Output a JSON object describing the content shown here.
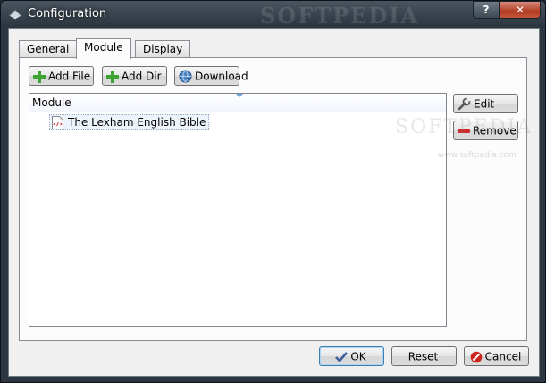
{
  "window": {
    "title": "Configuration",
    "watermark": "SOFTPEDIA",
    "help_label": "?",
    "close_label": "✕"
  },
  "tabs": [
    {
      "label": "General"
    },
    {
      "label": "Module",
      "active": true
    },
    {
      "label": "Display"
    }
  ],
  "toolbar": {
    "add_file": "Add File",
    "add_dir": "Add Dir",
    "download": "Download"
  },
  "modules": {
    "column_header": "Module",
    "items": [
      {
        "label": "The Lexham English Bible"
      }
    ]
  },
  "side_buttons": {
    "edit": "Edit",
    "remove": "Remove"
  },
  "dialog": {
    "ok": "OK",
    "reset": "Reset",
    "cancel": "Cancel"
  },
  "page_watermark": {
    "text": "SOFTPEDIA",
    "url": "www.softpedia.com"
  },
  "colors": {
    "add_icon": "#3aa531",
    "remove_icon": "#d02b2b",
    "cancel_icon": "#c9251b",
    "ok_check": "#3d5f9c",
    "selection": "#eef4fb"
  }
}
